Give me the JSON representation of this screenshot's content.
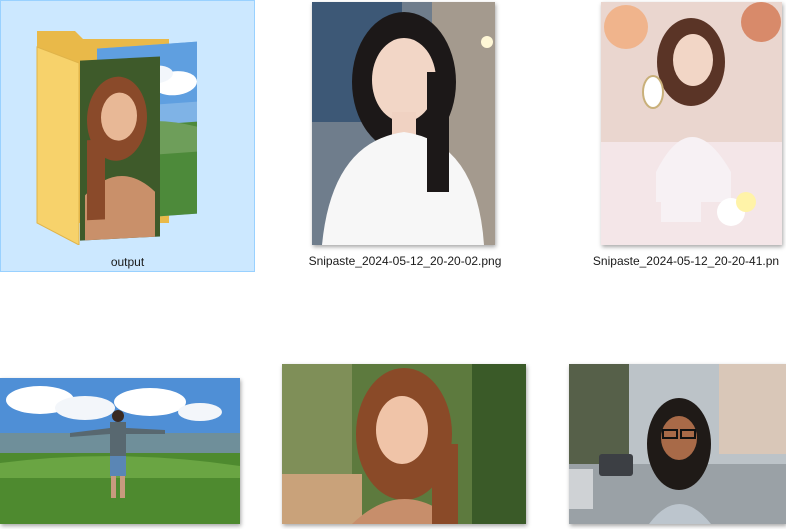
{
  "files": [
    {
      "label": "output",
      "type": "folder",
      "selected": true,
      "icon": "folder-with-photos-icon"
    },
    {
      "label": "Snipaste_2024-05-12_20-20-02.png",
      "type": "image",
      "icon": "portrait-woman-white-tshirt"
    },
    {
      "label": "Snipaste_2024-05-12_20-20-41.pn",
      "type": "image",
      "icon": "portrait-woman-holding-mirror"
    },
    {
      "label": "",
      "type": "image",
      "icon": "man-arms-outstretched-landscape"
    },
    {
      "label": "",
      "type": "image",
      "icon": "portrait-woman-auburn-hair"
    },
    {
      "label": "",
      "type": "image",
      "icon": "woman-glasses-street"
    }
  ],
  "colors": {
    "selection_bg": "#cce8ff",
    "selection_border": "#99d1ff",
    "folder_yellow": "#f5c755"
  }
}
